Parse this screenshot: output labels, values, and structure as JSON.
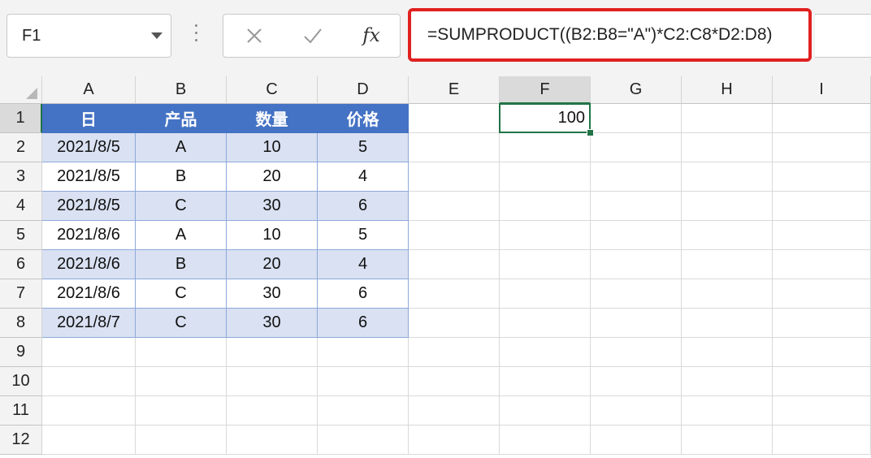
{
  "namebox": {
    "value": "F1"
  },
  "formula_bar": {
    "cancel_icon": "x-icon",
    "enter_icon": "check-icon",
    "fx_label": "fx",
    "formula": "=SUMPRODUCT((B2:B8=\"A\")*C2:C8*D2:D8)"
  },
  "columns": [
    "A",
    "B",
    "C",
    "D",
    "E",
    "F",
    "G",
    "H",
    "I"
  ],
  "rows": [
    "1",
    "2",
    "3",
    "4",
    "5",
    "6",
    "7",
    "8",
    "9",
    "10",
    "11",
    "12"
  ],
  "selected": {
    "column": "F",
    "row": "1"
  },
  "table": {
    "headers": [
      "日",
      "产品",
      "数量",
      "价格"
    ],
    "rows": [
      [
        "2021/8/5",
        "A",
        "10",
        "5"
      ],
      [
        "2021/8/5",
        "B",
        "20",
        "4"
      ],
      [
        "2021/8/5",
        "C",
        "30",
        "6"
      ],
      [
        "2021/8/6",
        "A",
        "10",
        "5"
      ],
      [
        "2021/8/6",
        "B",
        "20",
        "4"
      ],
      [
        "2021/8/6",
        "C",
        "30",
        "6"
      ],
      [
        "2021/8/7",
        "C",
        "30",
        "6"
      ]
    ]
  },
  "result_cell": {
    "ref": "F1",
    "value": "100"
  },
  "colors": {
    "table_header": "#4472c4",
    "table_band": "#d9e1f2",
    "selection": "#217346",
    "highlight_box": "#e02020"
  }
}
